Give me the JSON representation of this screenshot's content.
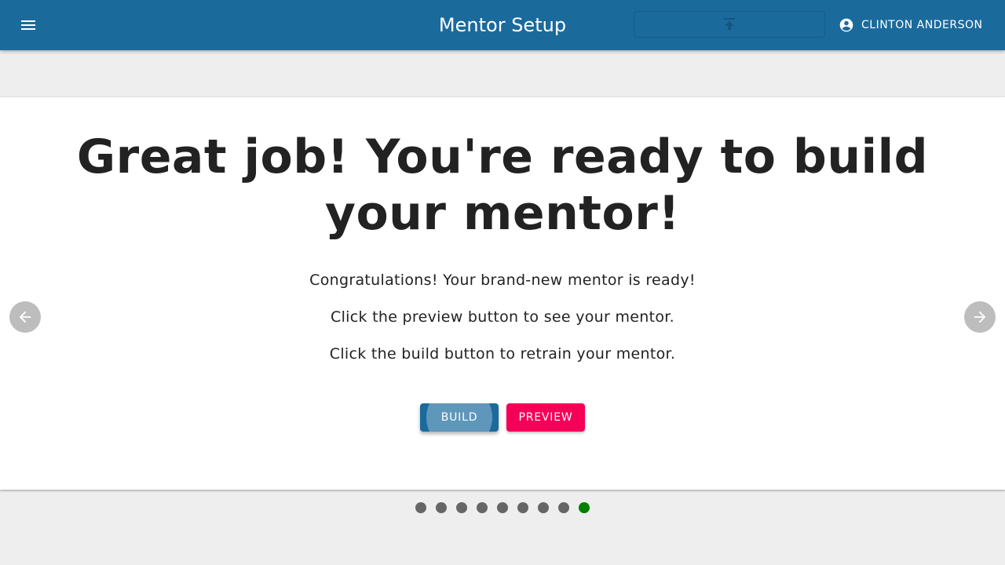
{
  "header": {
    "title": "Mentor Setup",
    "menu_icon": "menu-icon",
    "upload_icon": "upload-icon",
    "user_icon": "account-circle-icon",
    "user_name": "CLINTON ANDERSON",
    "background_color": "#1b6a9c"
  },
  "slide": {
    "headline": "Great job! You're ready to build your mentor!",
    "paragraphs": [
      "Congratulations! Your brand-new mentor is ready!",
      "Click the preview button to see your mentor.",
      "Click the build button to retrain your mentor."
    ],
    "build_label": "BUILD",
    "preview_label": "PREVIEW",
    "build_color": "#1b6a9c",
    "preview_color": "#f50057"
  },
  "carousel": {
    "prev_icon": "arrow-left-icon",
    "next_icon": "arrow-right-icon",
    "total_slides": 9,
    "active_index": 8,
    "active_color": "#008000",
    "inactive_color": "#666666"
  }
}
